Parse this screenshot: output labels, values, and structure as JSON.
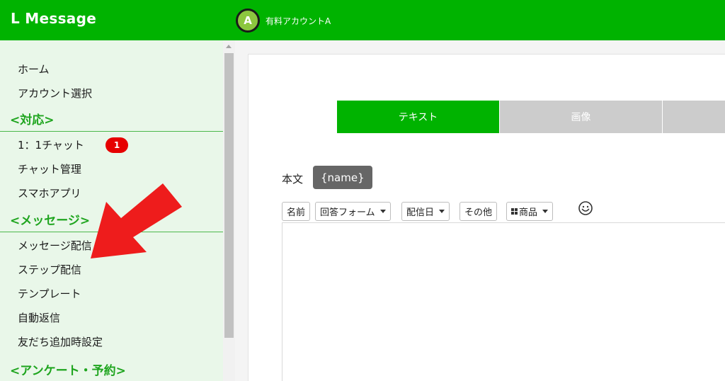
{
  "header": {
    "app_title": "L Message",
    "account": {
      "avatar_letter": "A",
      "name": "有料アカウントA"
    }
  },
  "sidebar": {
    "items_top": [
      "ホーム",
      "アカウント選択"
    ],
    "section_support": "<対応>",
    "items_support": [
      "1：1チャット",
      "チャット管理",
      "スマホアプリ"
    ],
    "chat_badge": "1",
    "section_message": "<メッセージ>",
    "items_message": [
      "メッセージ配信",
      "ステップ配信",
      "テンプレート",
      "自動返信",
      "友だち追加時設定"
    ],
    "section_survey": "<アンケート・予約>"
  },
  "main": {
    "tabs": [
      "テキスト",
      "画像",
      ""
    ],
    "active_tab": "テキスト",
    "body_label": "本文",
    "name_chip": "{name}",
    "toolbar": {
      "name": "名前",
      "answer_form": "回答フォーム",
      "delivery_date": "配信日",
      "other": "その他",
      "product": "商品"
    },
    "editor_value": ""
  },
  "colors": {
    "brand_green": "#00b300",
    "sidebar_bg": "#e9f7e9",
    "section_green": "#1fa51f",
    "badge_red": "#e60000",
    "tab_inactive": "#cccccc",
    "annotation_arrow": "#ee1c1c"
  },
  "icons": {
    "product": "grid-icon",
    "emoji": "smiley-icon",
    "annotation": "red-arrow-icon"
  }
}
